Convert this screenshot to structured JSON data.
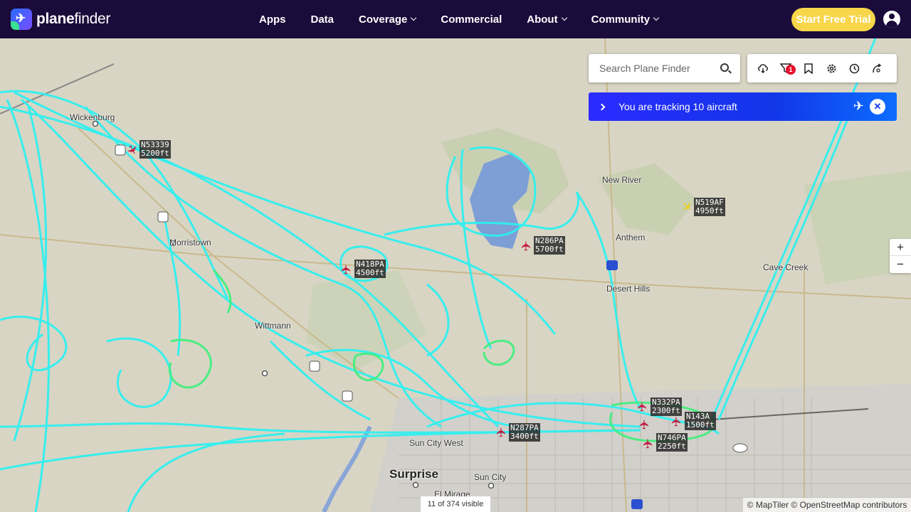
{
  "app": {
    "logo_mark": "✈",
    "logo_bold": "plane",
    "logo_light": "finder"
  },
  "nav": {
    "items": [
      {
        "label": "Apps",
        "dropdown": false
      },
      {
        "label": "Data",
        "dropdown": false
      },
      {
        "label": "Coverage",
        "dropdown": true
      },
      {
        "label": "Commercial",
        "dropdown": false
      },
      {
        "label": "About",
        "dropdown": true
      },
      {
        "label": "Community",
        "dropdown": true
      }
    ],
    "trial_label": "Start Free Trial"
  },
  "search": {
    "placeholder": "Search Plane Finder"
  },
  "toolbar": {
    "icons": [
      "cloud-icon",
      "filter-icon",
      "bookmark-icon",
      "settings-icon",
      "history-icon",
      "playback-icon"
    ],
    "filter_badge": "1"
  },
  "tracking": {
    "text": "You are tracking 10 aircraft",
    "close": "✕"
  },
  "zoom": {
    "in": "+",
    "out": "−"
  },
  "footer": {
    "visible": "11 of 374 visible",
    "attribution": "© MapTiler © OpenStreetMap contributors"
  },
  "places": [
    {
      "name": "Wickenburg"
    },
    {
      "name": "Morristown"
    },
    {
      "name": "Wittmann"
    },
    {
      "name": "New River"
    },
    {
      "name": "Anthem"
    },
    {
      "name": "Desert Hills"
    },
    {
      "name": "Cave Creek"
    },
    {
      "name": "Sun City West"
    },
    {
      "name": "Surprise"
    },
    {
      "name": "Sun City"
    },
    {
      "name": "El Mirage"
    }
  ],
  "aircraft": [
    {
      "callsign": "N53339",
      "altitude": "5200ft"
    },
    {
      "callsign": "N418PA",
      "altitude": "4500ft"
    },
    {
      "callsign": "N286PA",
      "altitude": "5700ft"
    },
    {
      "callsign": "N519AF",
      "altitude": "4950ft"
    },
    {
      "callsign": "N332PA",
      "altitude": "2300ft"
    },
    {
      "callsign": "N143A",
      "altitude": "1500ft"
    },
    {
      "callsign": "N746PA",
      "altitude": "2250ft"
    },
    {
      "callsign": "N287PA",
      "altitude": "3400ft"
    }
  ],
  "colors": {
    "nav_bg": "#1b0b3a",
    "trial": "#f7d64a",
    "track_cyan": "#2ff0f0",
    "track_green": "#3cf07a",
    "aircraft_red": "#c0183c",
    "aircraft_yellow": "#e8d020"
  }
}
